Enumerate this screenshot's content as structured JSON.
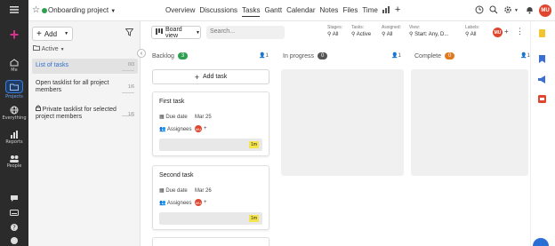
{
  "nav": {
    "items": [
      {
        "label": "Me"
      },
      {
        "label": "Projects"
      },
      {
        "label": "Everything"
      },
      {
        "label": "Reports"
      },
      {
        "label": "People"
      }
    ]
  },
  "header": {
    "project_title": "Onboarding project",
    "tabs": [
      "Overview",
      "Discussions",
      "Tasks",
      "Gantt",
      "Calendar",
      "Notes",
      "Files",
      "Time"
    ],
    "active_tab": "Tasks",
    "avatar_initials": "MU"
  },
  "tasklists": {
    "add_label": "Add",
    "filter_label": "Active",
    "items": [
      {
        "name": "List of tasks",
        "count": "0/3"
      },
      {
        "name": "Open tasklist for all project members",
        "count": "1/6"
      },
      {
        "name": "Private tasklist for selected project members",
        "count": "1/6"
      }
    ]
  },
  "toolbar": {
    "view_label": "Board view",
    "search_placeholder": "Search...",
    "filters": [
      {
        "key": "Stages:",
        "value": "All"
      },
      {
        "key": "Tasks:",
        "value": "Active"
      },
      {
        "key": "Assigned:",
        "value": "All"
      },
      {
        "key": "View:",
        "value": "Start: Any, D..."
      },
      {
        "key": "Labels:",
        "value": "All"
      }
    ],
    "avatar_initials": "MU"
  },
  "board": {
    "columns": [
      {
        "name": "Backlog",
        "count": "3",
        "users": "1",
        "color": "#2e9e4f"
      },
      {
        "name": "In progress",
        "count": "0",
        "users": "1",
        "color": "#555555"
      },
      {
        "name": "Complete",
        "count": "0",
        "users": "1",
        "color": "#e07a1f"
      }
    ],
    "add_task_label": "Add task",
    "cards": [
      {
        "title": "First task",
        "due_key": "Due date",
        "due_value": "Mar 25",
        "assignees_key": "Assignees",
        "assignee": "MU",
        "estimate": "1m"
      },
      {
        "title": "Second task",
        "due_key": "Due date",
        "due_value": "Mar 26",
        "assignees_key": "Assignees",
        "assignee": "MU",
        "estimate": "1m"
      }
    ]
  }
}
